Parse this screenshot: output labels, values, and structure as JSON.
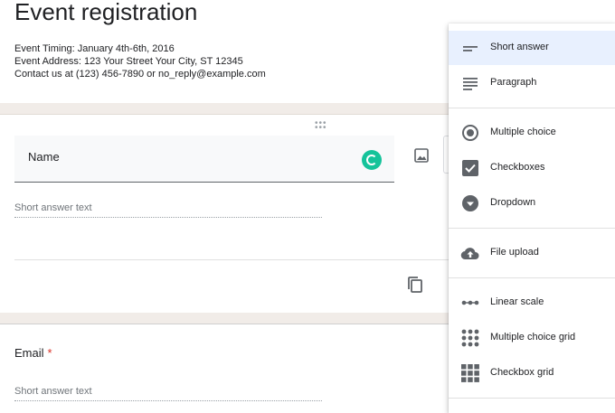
{
  "form": {
    "title": "Event registration",
    "description": [
      "Event Timing: January 4th-6th, 2016",
      "Event Address: 123 Your Street Your City, ST 12345",
      "Contact us at (123) 456-7890 or no_reply@example.com"
    ]
  },
  "questions": [
    {
      "title": "Name",
      "placeholder": "Short answer text"
    },
    {
      "title": "Email",
      "required_mark": "*",
      "placeholder": "Short answer text"
    }
  ],
  "question_type_menu": {
    "items": [
      {
        "label": "Short answer",
        "icon": "short-answer-icon",
        "selected": true
      },
      {
        "label": "Paragraph",
        "icon": "paragraph-icon"
      },
      {
        "label": "Multiple choice",
        "icon": "radio-button-icon"
      },
      {
        "label": "Checkboxes",
        "icon": "checkbox-icon"
      },
      {
        "label": "Dropdown",
        "icon": "dropdown-icon"
      },
      {
        "label": "File upload",
        "icon": "cloud-upload-icon"
      },
      {
        "label": "Linear scale",
        "icon": "linear-scale-icon"
      },
      {
        "label": "Multiple choice grid",
        "icon": "dot-grid-icon"
      },
      {
        "label": "Checkbox grid",
        "icon": "checkbox-grid-icon"
      }
    ]
  },
  "colors": {
    "accent": "#1a73e8",
    "selected_bg": "#e8f0fe",
    "icon": "#5f6368",
    "required": "#d93025",
    "grammarly": "#15c39a",
    "band": "#f1ece8"
  }
}
